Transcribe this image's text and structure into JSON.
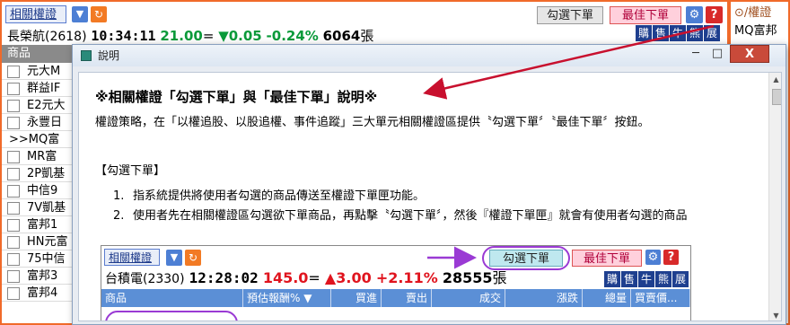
{
  "background_app": {
    "panel_title": "相關權證",
    "buttons": {
      "tick_select": "勾選下單",
      "best_order": "最佳下單",
      "help": "?"
    },
    "quote": {
      "name": "長榮航(2618)",
      "time": "10:34:11",
      "price": "21.00",
      "eq": "=",
      "change_arrow": "▼",
      "change": "0.05",
      "percent": "-0.24%",
      "volume": "6064",
      "volume_unit": "張"
    },
    "actions": [
      "購",
      "售",
      "牛",
      "熊",
      "展"
    ],
    "list_header": "商品",
    "list_items": [
      "元大M",
      "群益IF",
      "E2元大",
      "永豐日",
      ">>MQ富",
      "MR富",
      "2P凱基",
      "中信9",
      "7V凱基",
      "富邦1",
      "HN元富",
      "75中信",
      "富邦3",
      "富邦4"
    ]
  },
  "side_panel": {
    "title": "權證",
    "item": "MQ富邦"
  },
  "dialog": {
    "title": "說明",
    "window_buttons": {
      "minimize": "─",
      "maximize": "□",
      "close": "X"
    },
    "doc_title": "※相關權證「勾選下單」與「最佳下單」說明※",
    "intro": "權證策略，在「以權追股、以股追權、事件追蹤」三大單元相關權證區提供〝勾選下單〞〝最佳下單〞按鈕。",
    "section_title": "【勾選下單】",
    "items": [
      "指系統提供將使用者勾選的商品傳送至權證下單匣功能。",
      "使用者先在相關權證區勾選欲下單商品，再點擊〝勾選下單〞，然後『權證下單匣』就會有使用者勾選的商品"
    ],
    "embedded": {
      "panel_title": "相關權證",
      "tick_select": "勾選下單",
      "best_order": "最佳下單",
      "help": "?",
      "quote": {
        "name": "台積電(2330)",
        "time": "12:28:02",
        "price": "145.0",
        "eq": "=",
        "change_arrow": "▲",
        "change": "3.00",
        "percent": "+2.11%",
        "volume": "28555",
        "volume_unit": "張"
      },
      "actions": [
        "購",
        "售",
        "牛",
        "熊",
        "展"
      ],
      "columns": [
        "商品",
        "預估報酬%",
        "買進",
        "賣出",
        "成交",
        "漲跌",
        "總量",
        "買賣價..."
      ]
    }
  },
  "colors": {
    "border_orange": "#f06a2a",
    "arrow_red": "#c8102e",
    "annotation_purple": "#9a3ad4",
    "up_red": "#e0141e",
    "down_green": "#0a9a3a"
  }
}
